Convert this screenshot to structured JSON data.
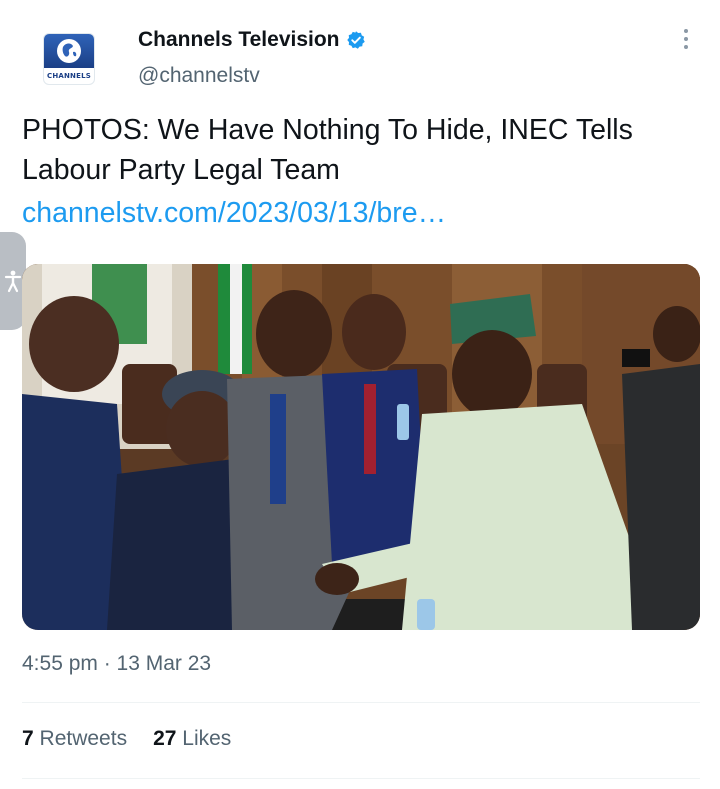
{
  "author": {
    "display_name": "Channels Television",
    "handle": "@channelstv",
    "avatar_brand": "CHANNELS",
    "verified_icon": "verified-badge-icon"
  },
  "tweet": {
    "text": "PHOTOS: We Have Nothing To Hide, INEC Tells Labour Party Legal Team",
    "link": "channelstv.com/2023/03/13/bre…",
    "timestamp": "4:55 pm · 13 Mar 23"
  },
  "stats": {
    "retweets_count": "7",
    "retweets_label": "Retweets",
    "likes_count": "27",
    "likes_label": "Likes"
  },
  "icons": {
    "more": "more-options-icon",
    "accessibility": "accessibility-icon"
  },
  "colors": {
    "link": "#1d9bf0",
    "verified": "#1d9bf0",
    "secondary_text": "#536471",
    "primary_text": "#0f1419"
  }
}
